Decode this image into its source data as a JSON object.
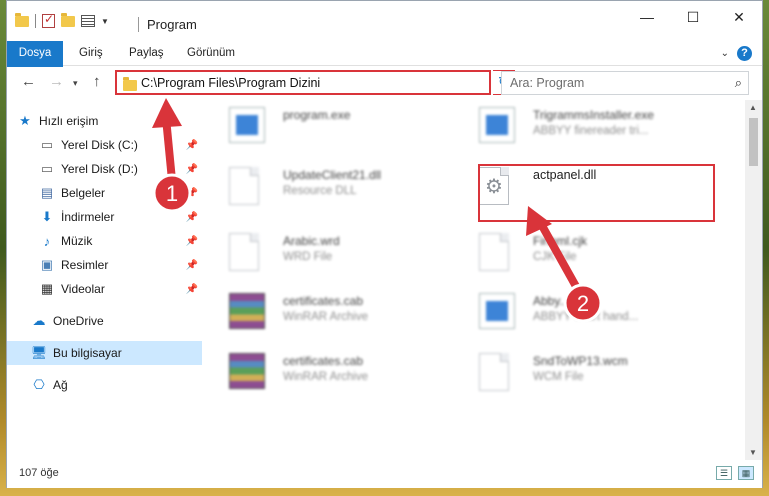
{
  "window": {
    "title": "Program",
    "controls": {
      "minimize": "—",
      "maximize": "☐",
      "close": "✕"
    }
  },
  "ribbon": {
    "tabs": [
      "Dosya",
      "Giriş",
      "Paylaş",
      "Görünüm"
    ],
    "help": "?"
  },
  "address": {
    "path": "C:\\Program Files\\Program Dizini",
    "search_placeholder": "Ara: Program"
  },
  "sidebar": {
    "items": [
      {
        "label": "Hızlı erişim",
        "icon": "star-icon",
        "pinned": false
      },
      {
        "label": "Yerel Disk (C:)",
        "icon": "drive-icon",
        "pinned": true
      },
      {
        "label": "Yerel Disk (D:)",
        "icon": "drive-icon",
        "pinned": true
      },
      {
        "label": "Belgeler",
        "icon": "documents-icon",
        "pinned": true
      },
      {
        "label": "İndirmeler",
        "icon": "download-icon",
        "pinned": true
      },
      {
        "label": "Müzik",
        "icon": "music-icon",
        "pinned": true
      },
      {
        "label": "Resimler",
        "icon": "pictures-icon",
        "pinned": true
      },
      {
        "label": "Videolar",
        "icon": "videos-icon",
        "pinned": true
      },
      {
        "label": "OneDrive",
        "icon": "cloud-icon",
        "pinned": false
      },
      {
        "label": "Bu bilgisayar",
        "icon": "computer-icon",
        "pinned": false
      },
      {
        "label": "Ağ",
        "icon": "network-icon",
        "pinned": false
      }
    ],
    "selected": "Bu bilgisayar"
  },
  "files": [
    {
      "name": "program.exe",
      "type": "",
      "icon": "exe-icon"
    },
    {
      "name": "TrigrammsInstaller.exe",
      "type": "ABBYY finereader tri...",
      "icon": "app-icon"
    },
    {
      "name": "UpdateClient21.dll",
      "type": "Resource DLL",
      "icon": "dll-icon"
    },
    {
      "name": "actpanel.dll",
      "type": "",
      "icon": "dll-gear-icon",
      "highlighted": true
    },
    {
      "name": "Arabic.wrd",
      "type": "WRD File",
      "icon": "document-icon"
    },
    {
      "name": "Finhml.cjk",
      "type": "CJK File",
      "icon": "document-icon"
    },
    {
      "name": "certificates.cab",
      "type": "WinRAR Archive",
      "icon": "rar-icon"
    },
    {
      "name": "Abby...exe",
      "type": "ABBYY chart hand...",
      "icon": "app-icon"
    },
    {
      "name": "certificates.cab",
      "type": "WinRAR Archive",
      "icon": "rar-icon"
    },
    {
      "name": "SndToWP13.wcm",
      "type": "WCM File",
      "icon": "document-icon"
    }
  ],
  "annotations": {
    "step1": "1",
    "step2": "2"
  },
  "status": {
    "count": "107 öğe"
  },
  "colors": {
    "accent": "#1979ca",
    "highlight": "#d9343a",
    "selected_bg": "#cce8ff"
  }
}
